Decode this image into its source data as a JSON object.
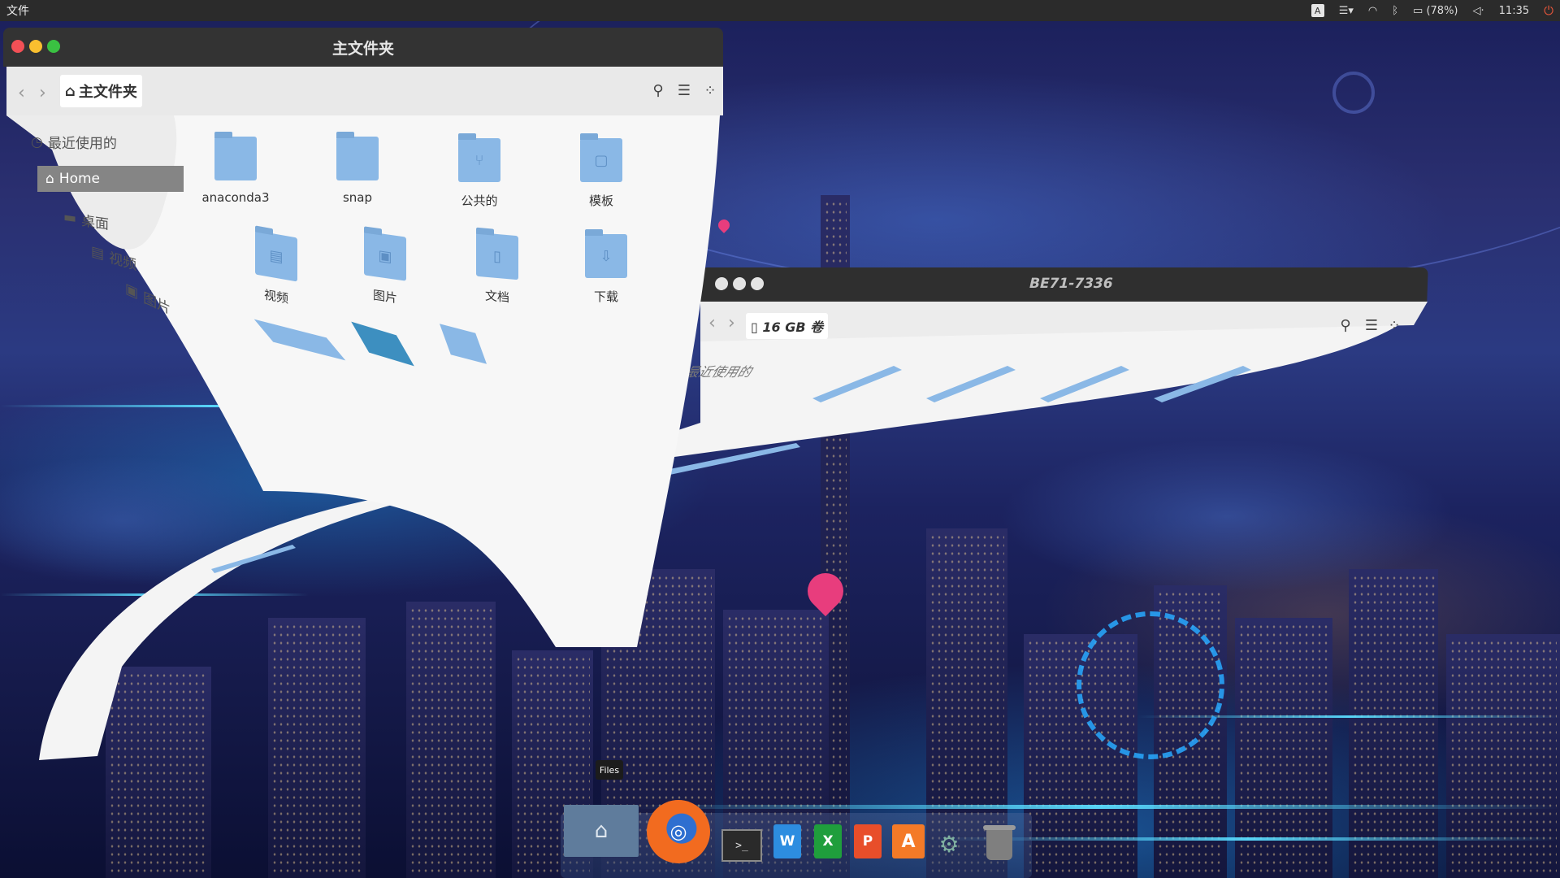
{
  "top_panel": {
    "app_menu": "文件",
    "keyboard_indicator": "A",
    "battery_text": "(78%)",
    "clock": "11:35"
  },
  "window_home": {
    "title": "主文件夹",
    "path_label": "主文件夹",
    "sidebar": [
      {
        "label": "最近使用的"
      },
      {
        "label": "Home"
      },
      {
        "label": "桌面"
      },
      {
        "label": "视频"
      },
      {
        "label": "图片"
      }
    ],
    "folders": [
      {
        "label": "anaconda3"
      },
      {
        "label": "snap"
      },
      {
        "label": "公共的"
      },
      {
        "label": "模板"
      },
      {
        "label": "视频"
      },
      {
        "label": "图片"
      },
      {
        "label": "文档"
      },
      {
        "label": "下载"
      }
    ]
  },
  "window_volume": {
    "title": "BE71-7336",
    "path_label": "16 GB 卷",
    "sidebar_recent": "最近使用的"
  },
  "dock": {
    "tooltip": "Files",
    "items": [
      {
        "name": "files"
      },
      {
        "name": "firefox"
      },
      {
        "name": "terminal",
        "glyph": ">_"
      },
      {
        "name": "wps-writer",
        "glyph": "W"
      },
      {
        "name": "wps-spreadsheets",
        "glyph": "X"
      },
      {
        "name": "wps-presentation",
        "glyph": "P"
      },
      {
        "name": "software-center",
        "glyph": "A"
      },
      {
        "name": "system-settings"
      },
      {
        "name": "trash"
      }
    ]
  },
  "colors": {
    "panel": "#2b2b2b",
    "titlebar": "#333333",
    "folder": "#8ab8e6",
    "close": "#f25056",
    "minimize": "#f9bf2f",
    "maximize": "#3ac142"
  }
}
